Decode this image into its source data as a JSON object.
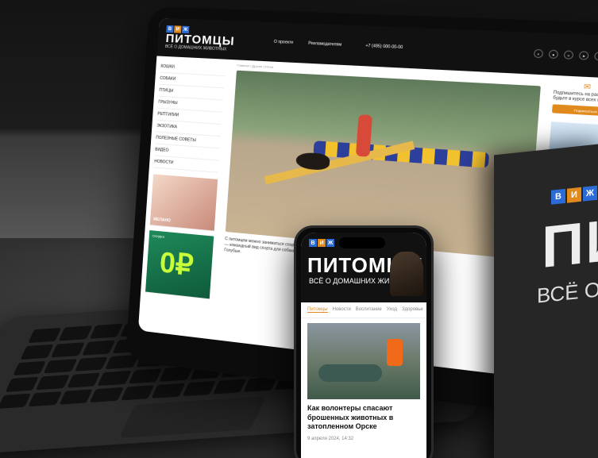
{
  "brand": {
    "letters": [
      "В",
      "И",
      "Ж"
    ],
    "name": "ПИТОМЦЫ",
    "tagline": "ВСЁ О ДОМАШНИХ ЖИВОТНЫХ"
  },
  "tablet": {
    "nav": [
      "О проекте",
      "Рекламодателям"
    ],
    "phone": "+7 (495) 000-00-00",
    "crumbs": "Главная / Другие статьи",
    "sidebar": [
      "КОШКИ",
      "СОБАКИ",
      "ПТИЦЫ",
      "ГРЫЗУНЫ",
      "РЕПТИЛИИ",
      "ЭКЗОТИКА",
      "ПОЛЕЗНЫЕ СОВЕТЫ",
      "ВИДЕО",
      "НОВОСТИ"
    ],
    "ad1_label": "МЕЛАНО",
    "ad2_top": "СКИДКА",
    "ad2_big": "0₽",
    "caption": "С питомцем можно заниматься спортом. Аджилити — командный вид спорта для собаки и хозяина. Голубые.",
    "subscribe_text": "Подпишитесь на рассылку и будьте в курсе всех новостей",
    "subscribe_btn": "Подписаться"
  },
  "panel": {
    "big": "ПИ",
    "sub": "ВСЁ О"
  },
  "phone": {
    "tabs": [
      "Питомцы",
      "Новости",
      "Воспитание",
      "Уход",
      "Здоровье"
    ],
    "headline": "Как волонтеры спасают брошенных животных в затопленном Орске",
    "date": "9 апреля 2024, 14:32"
  }
}
